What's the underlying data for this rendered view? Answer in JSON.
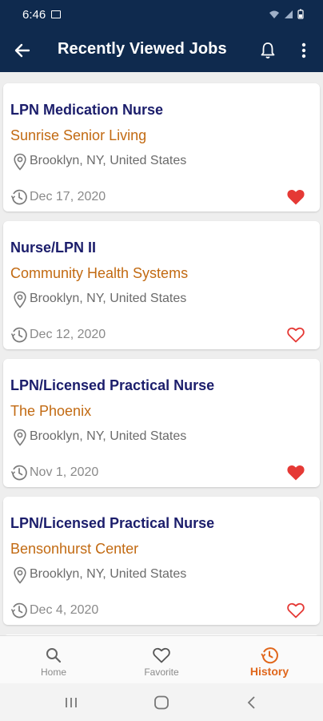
{
  "status_bar": {
    "time": "6:46"
  },
  "header": {
    "title": "Recently Viewed Jobs"
  },
  "jobs": [
    {
      "title": "LPN Medication Nurse",
      "company": "Sunrise Senior Living",
      "location": "Brooklyn, NY, United States",
      "date": "Dec 17, 2020",
      "favorite": true
    },
    {
      "title": "Nurse/LPN II",
      "company": "Community Health Systems",
      "location": "Brooklyn, NY, United States",
      "date": "Dec 12, 2020",
      "favorite": false
    },
    {
      "title": "LPN/Licensed Practical Nurse",
      "company": "The Phoenix",
      "location": "Brooklyn, NY, United States",
      "date": "Nov 1, 2020",
      "favorite": true
    },
    {
      "title": "LPN/Licensed Practical Nurse",
      "company": "Bensonhurst Center",
      "location": "Brooklyn, NY, United States",
      "date": "Dec 4, 2020",
      "favorite": false
    }
  ],
  "bottom_nav": {
    "home_label": "Home",
    "favorite_label": "Favorite",
    "history_label": "History",
    "active": "history"
  },
  "colors": {
    "header_bg": "#0f2a4e",
    "title_text": "#1b1d6b",
    "company_text": "#c26a12",
    "favorite_red": "#e53935",
    "active_nav": "#e0661b"
  }
}
